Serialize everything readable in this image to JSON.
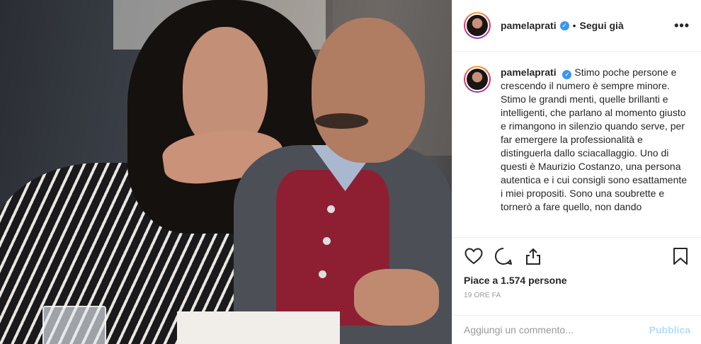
{
  "post": {
    "username": "pamelaprati",
    "follow_label": "Segui già",
    "separator": "•",
    "more_label": "•••",
    "caption": {
      "username": "pamelaprati",
      "text": "Stimo poche persone e crescendo il numero è sempre minore. Stimo le grandi menti, quelle brillanti e intelligenti, che parlano al momento giusto e rimangono in silenzio quando serve, per far emergere la professionalità e distinguerla dallo sciacallaggio. Uno di questi è Maurizio Costanzo, una persona autentica e i cui consigli sono esattamente i miei propositi. Sono una soubrette e tornerò a fare quello, non dando"
    },
    "likes_label": "Piace a 1.574 persone",
    "time_label": "19 ORE FA",
    "comment": {
      "placeholder": "Aggiungi un commento...",
      "publish_label": "Pubblica"
    },
    "colors": {
      "verified": "#3897f0",
      "publish_disabled": "#b2dffc",
      "border": "#efefef"
    },
    "icons": [
      "like-icon",
      "comment-icon",
      "share-icon",
      "bookmark-icon",
      "verified-icon",
      "more-icon"
    ]
  }
}
